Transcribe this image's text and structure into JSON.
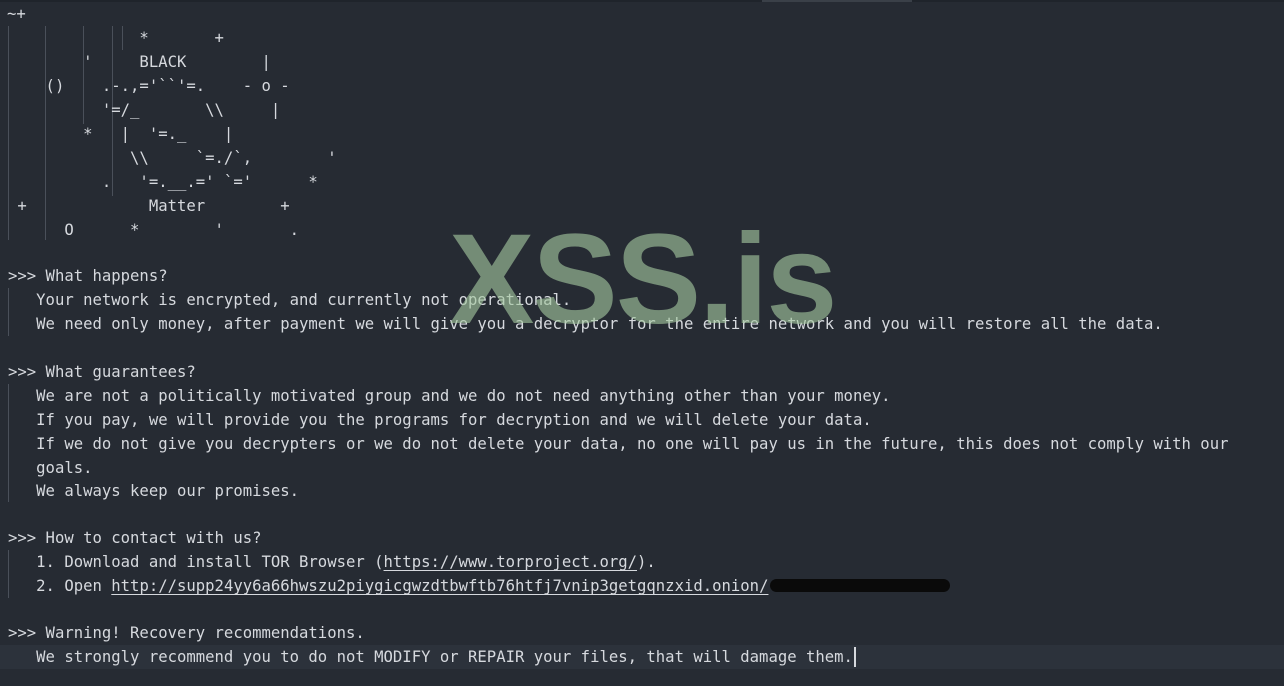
{
  "editor": {
    "first_line": "~+",
    "ascii_art": [
      "              *       +",
      "        '     BLACK        |",
      "    ()    .-.,='``'=.    - o -",
      "          '=/_       \\\\     |",
      "        *   |  '=._    |",
      "             \\\\     `=./`,        '",
      "          .   '=.__.=' `='      *",
      " +             Matter        +",
      "      O      *        '       ."
    ],
    "section1_heading": ">>> What happens?",
    "section1_line1": "   Your network is encrypted, and currently not operational.",
    "section1_line2": "   We need only money, after payment we will give you a decryptor for the entire network and you will restore all the data.",
    "section2_heading": ">>> What guarantees?",
    "section2_line1": "   We are not a politically motivated group and we do not need anything other than your money.",
    "section2_line2": "   If you pay, we will provide you the programs for decryption and we will delete your data.",
    "section2_line3": "   If we do not give you decrypters or we do not delete your data, no one will pay us in the future, this does not comply with our",
    "section2_line4": "   goals.",
    "section2_line5": "   We always keep our promises.",
    "section3_heading": ">>> How to contact with us?",
    "step1_prefix": "   1. Download and install TOR Browser (",
    "step1_link": "https://www.torproject.org/",
    "step1_suffix": ").",
    "step2_prefix": "   2. Open ",
    "step2_link": "http://supp24yy6a66hwszu2piygicgwzdtbwftb76htfj7vnip3getgqnzxid.onion/",
    "section4_heading": ">>> Warning! Recovery recommendations.",
    "section4_line1": "   We strongly recommend you to do not MODIFY or REPAIR your files, that will damage them."
  },
  "watermark": "XSS.is",
  "colors": {
    "background": "#262b33",
    "text": "#d6d9de",
    "current_line": "#2c323b",
    "watermark": "#a5c8a0"
  }
}
